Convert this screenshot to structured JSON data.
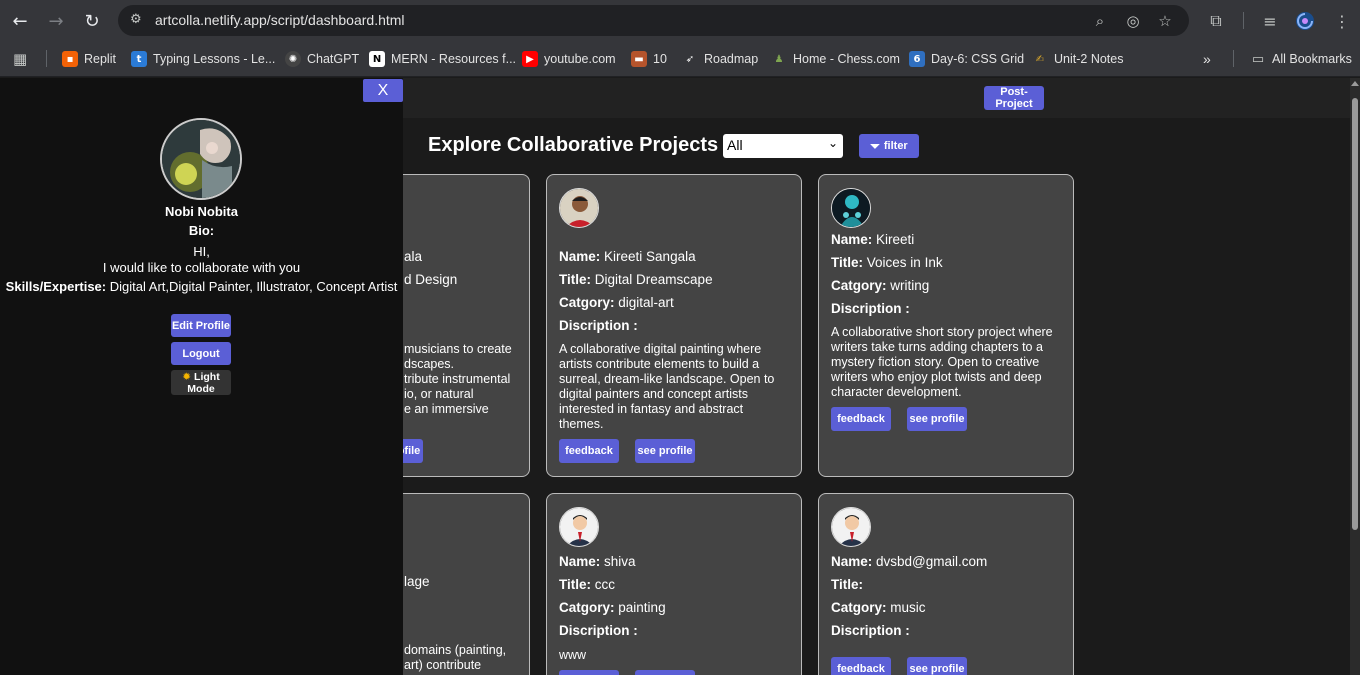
{
  "browser": {
    "url": "artcolla.netlify.app/script/dashboard.html",
    "bookmarks": [
      {
        "label": "Replit",
        "icon": "replit-icon",
        "color": "#f26207"
      },
      {
        "label": "Typing Lessons - Le...",
        "icon": "typing-icon",
        "color": "#2b7bd6"
      },
      {
        "label": "ChatGPT",
        "icon": "chatgpt-icon",
        "color": "#444"
      },
      {
        "label": "MERN - Resources f...",
        "icon": "notion-icon",
        "color": "#222"
      },
      {
        "label": "youtube.com",
        "icon": "youtube-icon",
        "color": "#ff0000"
      },
      {
        "label": "10",
        "icon": "briefcase-icon",
        "color": "#b5542c"
      },
      {
        "label": "Roadmap",
        "icon": "rocket-icon",
        "color": "#555"
      },
      {
        "label": "Home - Chess.com",
        "icon": "chess-icon",
        "color": "#7fa650"
      },
      {
        "label": "Day-6: CSS Grid",
        "icon": "six-icon",
        "color": "#2f6fc0"
      },
      {
        "label": "Unit-2 Notes",
        "icon": "pen-icon",
        "color": "#d9a72b"
      }
    ],
    "all_bookmarks": "All Bookmarks"
  },
  "header": {
    "post_project": "Post-Project",
    "title": "Explore Collaborative Projects",
    "select_value": "All",
    "filter_label": "filter"
  },
  "sidebar": {
    "close": "X",
    "name": "Nobi Nobita",
    "bio_label": "Bio:",
    "bio_line1": "HI,",
    "bio_line2": "I would like to collaborate with you",
    "skills_label": "Skills/Expertise:",
    "skills_value": "Digital Art,Digital Painter, Illustrator, Concept Artist",
    "edit_profile": "Edit Profile",
    "logout": "Logout",
    "mode_icon": "sun-icon",
    "mode_line1": "Light",
    "mode_line2": "Mode"
  },
  "labels": {
    "name": "Name:",
    "title": "Title:",
    "category": "Catgory:",
    "description": "Discription :",
    "feedback": "feedback",
    "see_profile": "see profile"
  },
  "cards": [
    {
      "partial_name": "ala",
      "partial_title": "d Design",
      "desc_lines": [
        "musicians to create",
        "dscapes.",
        "tribute instrumental",
        "io, or natural",
        "e an immersive"
      ],
      "partial_button": "ofile"
    },
    {
      "name": "Kireeti Sangala",
      "title": "Digital Dreamscape",
      "category": "digital-art",
      "description": "A collaborative digital painting where artists contribute elements to build a surreal, dream-like landscape. Open to digital painters and concept artists interested in fantasy and abstract themes."
    },
    {
      "name": "Kireeti",
      "title": "Voices in Ink",
      "category": "writing",
      "description": "A collaborative short story project where writers take turns adding chapters to a mystery fiction story. Open to creative writers who enjoy plot twists and deep character development."
    },
    {
      "partial_title": "lage",
      "desc_lines": [
        "domains (painting,",
        "art) contribute"
      ]
    },
    {
      "name": "shiva",
      "title": "ccc",
      "category": "painting",
      "description": "www"
    },
    {
      "name": "dvsbd@gmail.com",
      "title": "",
      "category": "music",
      "description": ""
    }
  ]
}
